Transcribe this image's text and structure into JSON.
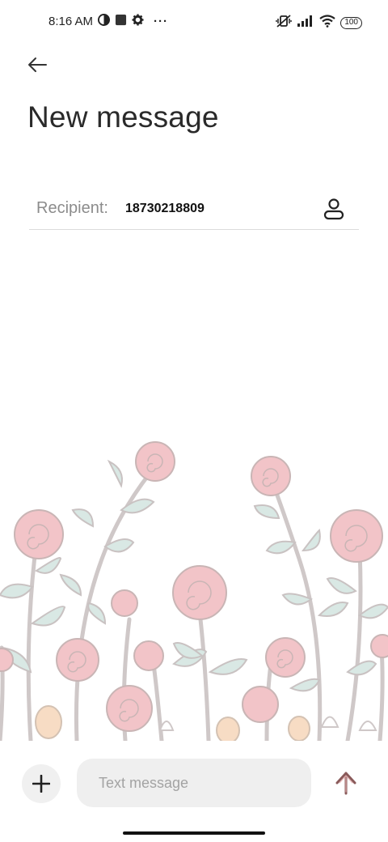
{
  "status_bar": {
    "time": "8:16 AM",
    "left_icons": [
      "vpn-icon",
      "app-square-icon",
      "gear-icon",
      "more-dots-icon"
    ],
    "right_icons": [
      "mute-vibrate-icon",
      "signal-icon",
      "wifi-icon",
      "battery-icon"
    ],
    "battery_level": "100",
    "more_dots": "···"
  },
  "header": {
    "back_icon": "back-arrow-icon",
    "title": "New message"
  },
  "recipient": {
    "label": "Recipient:",
    "value": "18730218809",
    "contact_icon": "contact-person-icon"
  },
  "compose": {
    "add_icon": "plus-icon",
    "placeholder": "Text message",
    "send_icon": "send-arrow-icon"
  },
  "colors": {
    "rose": "#f2c4c8",
    "rose_stroke": "#c9b5b5",
    "leaf": "#d9e8e4",
    "stem": "#cfc8c8",
    "bud": "#f7dcc4",
    "send": "#8a5a5a"
  }
}
